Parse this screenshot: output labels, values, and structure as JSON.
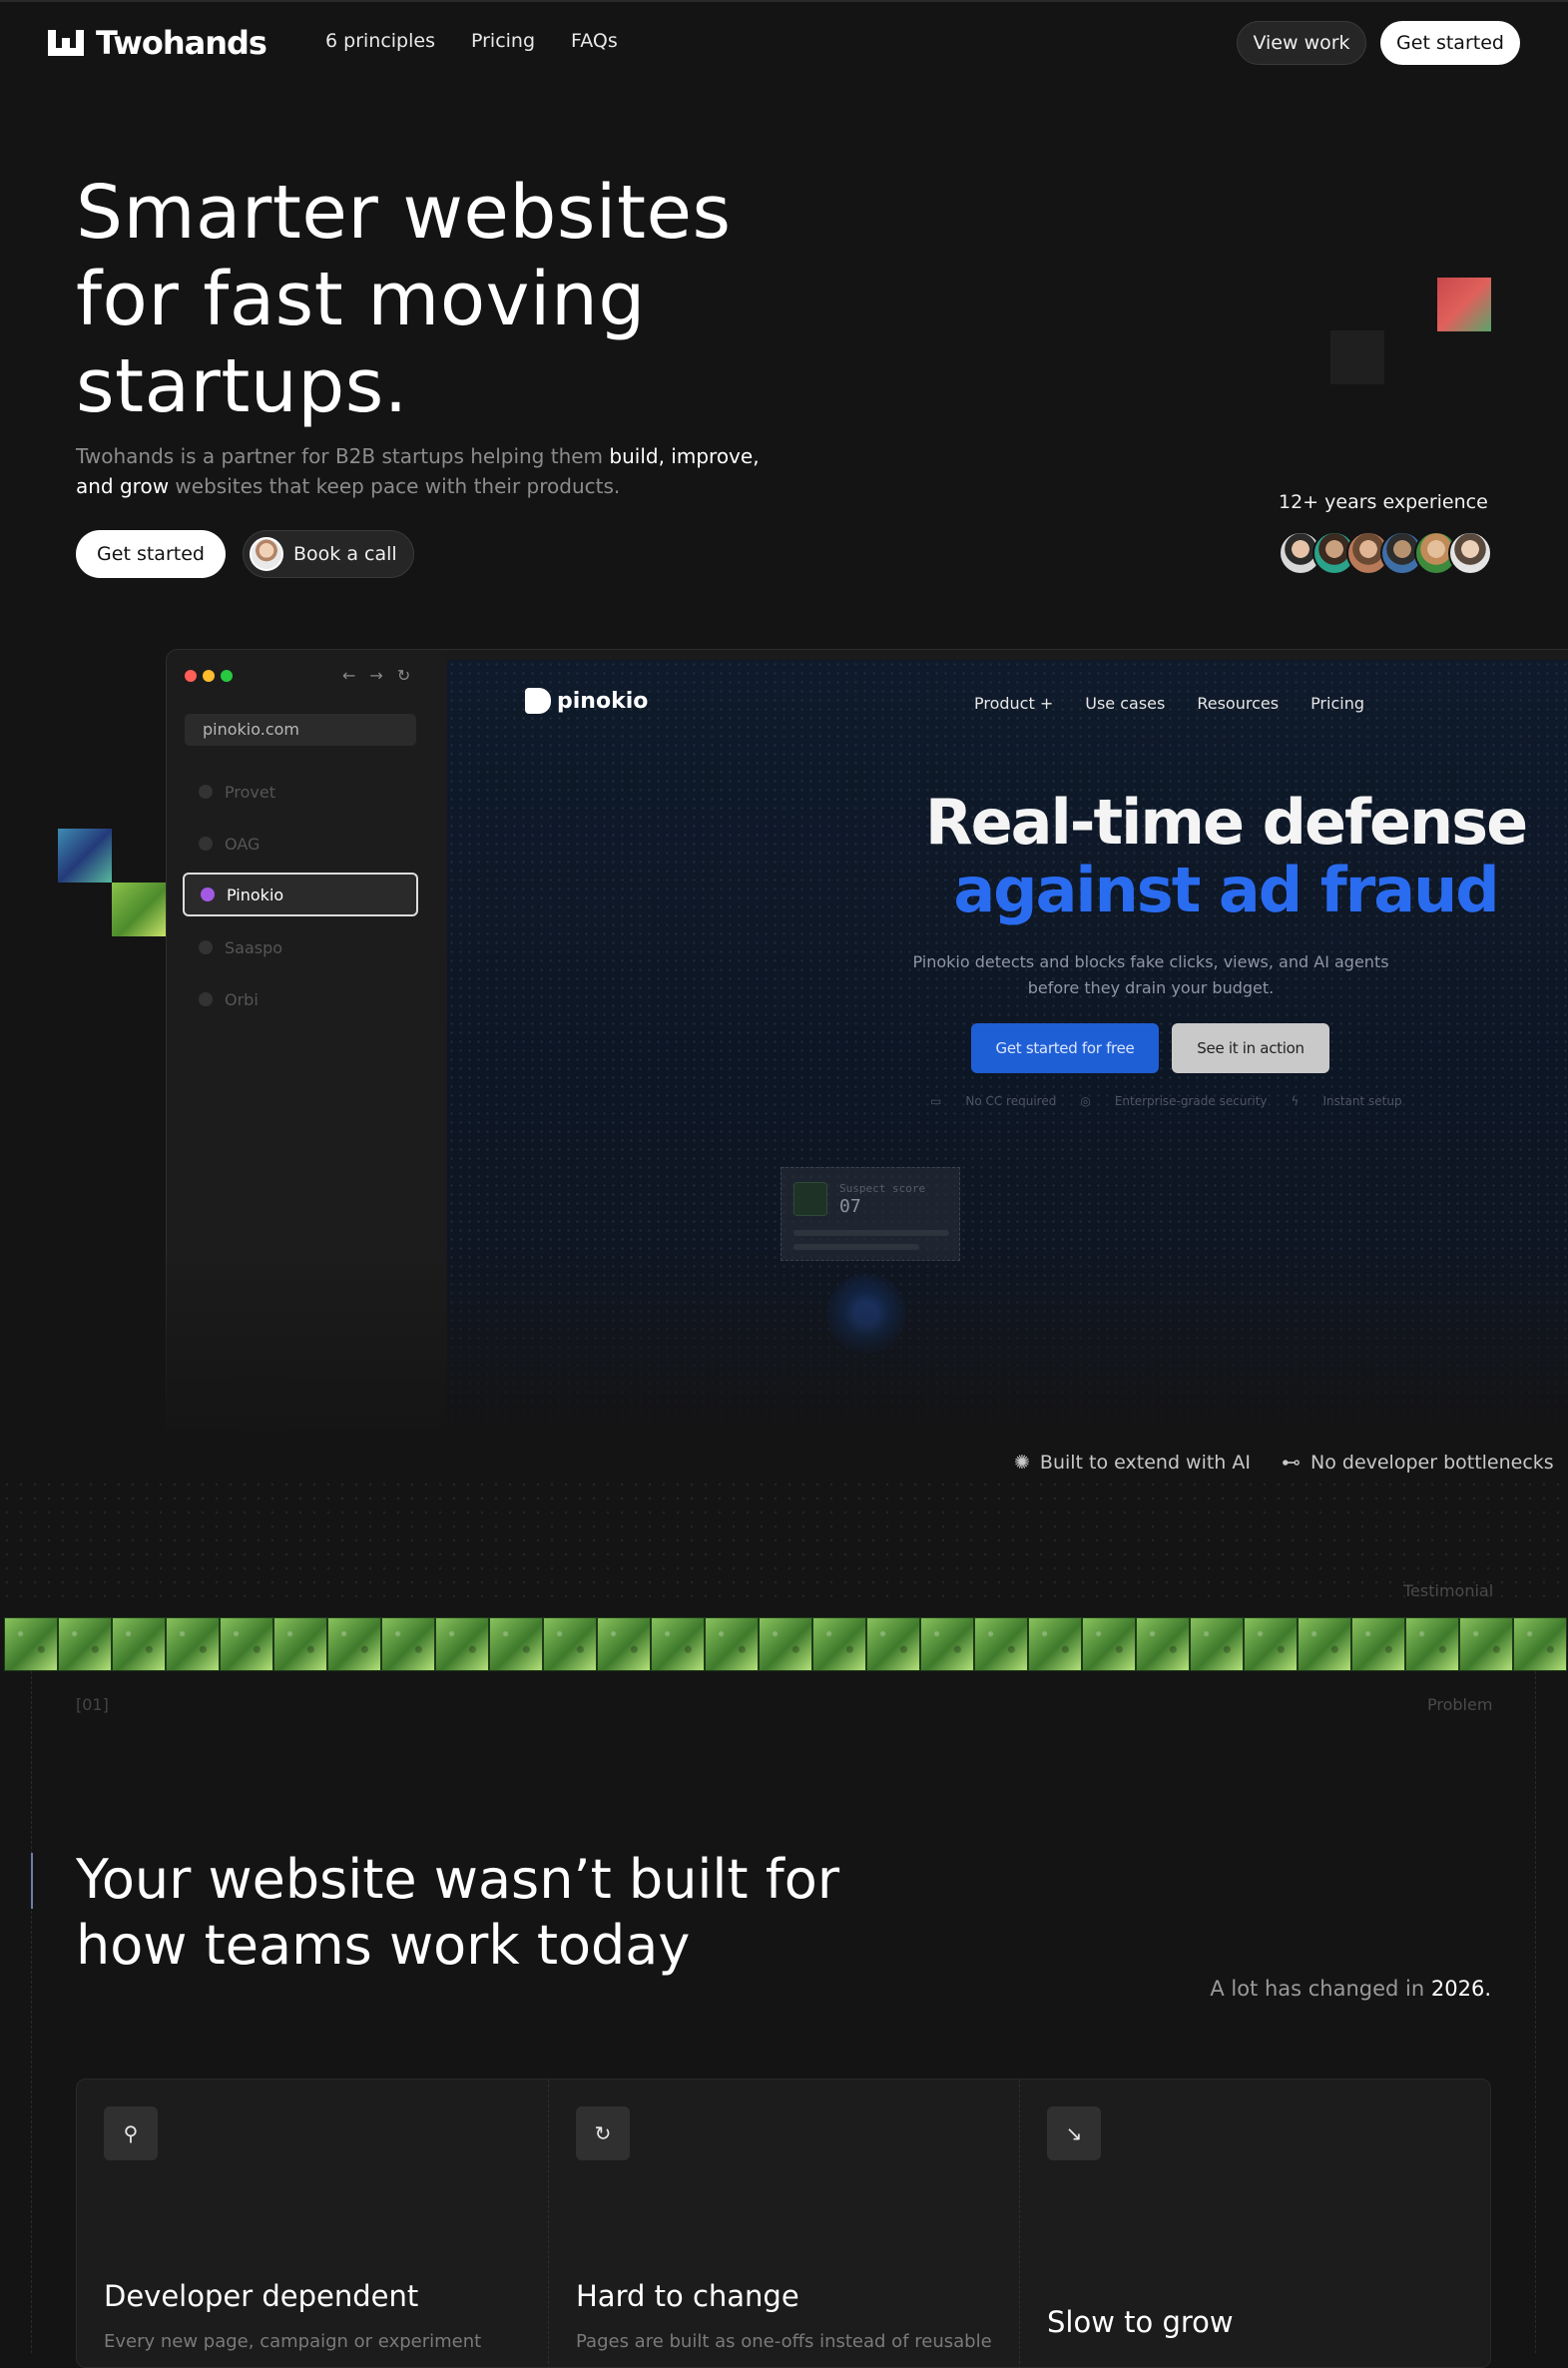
{
  "nav": {
    "brand": "Twohands",
    "links": [
      "6 principles",
      "Pricing",
      "FAQs"
    ],
    "view_work": "View work",
    "get_started": "Get started"
  },
  "hero": {
    "title_lines": [
      "Smarter websites",
      "for fast moving",
      "startups."
    ],
    "sub_pre": "Twohands is a partner for B2B startups helping them ",
    "sub_em": "build, improve, and grow",
    "sub_post": " websites that keep pace with their products.",
    "cta_primary": "Get started",
    "cta_secondary": "Book a call",
    "experience": "12+ years experience"
  },
  "browser": {
    "url": "pinokio.com",
    "sites": [
      "Provet",
      "OAG",
      "Pinokio",
      "Saaspo",
      "Orbi"
    ],
    "active_site": "Pinokio"
  },
  "preview": {
    "brand": "pinokio",
    "nav": [
      "Product +",
      "Use cases",
      "Resources",
      "Pricing"
    ],
    "title_1": "Real-time defense",
    "title_2": "against ad fraud",
    "subtitle": "Pinokio detects and blocks fake clicks, views, and AI agents before they drain your budget.",
    "cta_primary": "Get started for free",
    "cta_secondary": "See it in action",
    "badges": [
      "No CC required",
      "Enterprise-grade security",
      "Instant setup"
    ],
    "card_label": "Suspect score",
    "card_value": "07"
  },
  "features": [
    "Built to extend with AI",
    "No developer bottlenecks"
  ],
  "testimonial_label": "Testimonial",
  "section": {
    "number": "[01]",
    "tag": "Problem",
    "title_lines": [
      "Your website wasn’t built for",
      "how teams work today"
    ],
    "aside_pre": "A lot has changed in ",
    "aside_year": "2026.",
    "cards": [
      {
        "title": "Developer dependent",
        "text": "Every new page, campaign or experiment"
      },
      {
        "title": "Hard to change",
        "text": "Pages are built as one-offs instead of reusable"
      },
      {
        "title": "Slow to grow",
        "text": ""
      }
    ]
  },
  "colors": {
    "background": "#141414",
    "accent_blue": "#2a6cf0",
    "active_dot": "#a35ae3"
  }
}
